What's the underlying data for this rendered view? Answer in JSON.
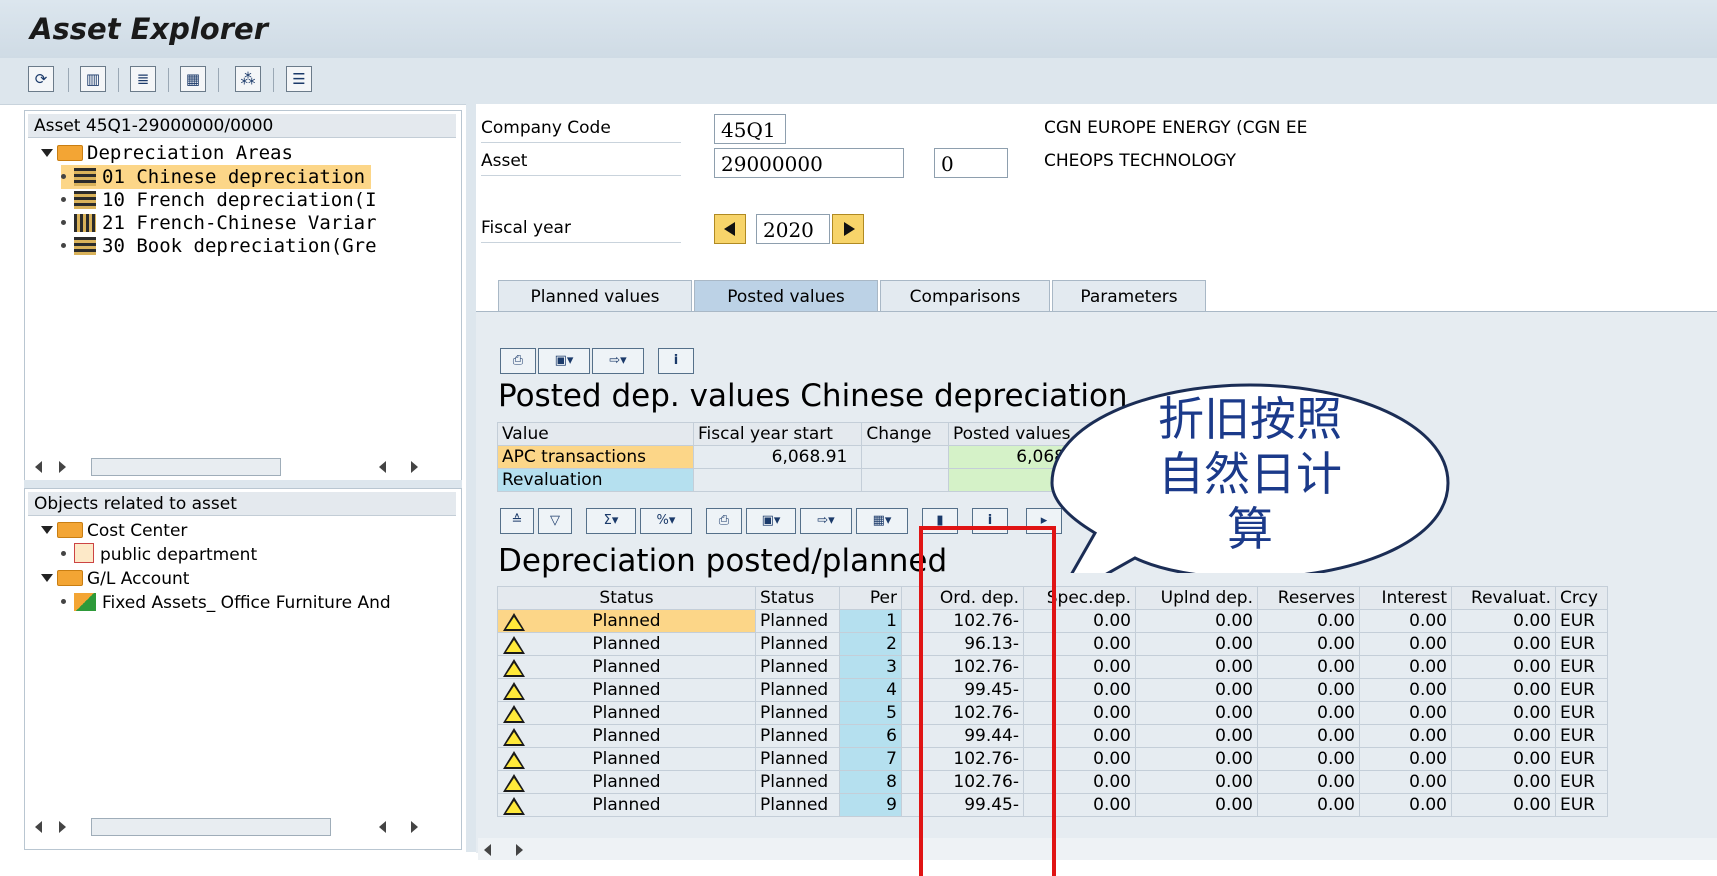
{
  "app": {
    "title": "Asset Explorer"
  },
  "toolbar": {
    "icons": [
      "refresh-icon",
      "save-icon",
      "filter-icon",
      "layout-icon",
      "hierarchy-icon",
      "list-icon"
    ]
  },
  "tree": {
    "header": "Asset 45Q1-29000000/0000",
    "root_label": "Depreciation Areas",
    "items": [
      {
        "label": "01 Chinese depreciation"
      },
      {
        "label": "10 French depreciation(I"
      },
      {
        "label": "21 French-Chinese Variar"
      },
      {
        "label": "30 Book depreciation(Gre"
      }
    ]
  },
  "objects": {
    "header": "Objects related to asset",
    "cost_center": "Cost Center",
    "cost_center_item": "public department",
    "gl_account": "G/L Account",
    "gl_item": "Fixed Assets_ Office Furniture And"
  },
  "header_fields": {
    "company_code_label": "Company Code",
    "company_code_value": "45Q1",
    "company_name": "CGN EUROPE ENERGY (CGN EE",
    "asset_label": "Asset",
    "asset_value": "29000000",
    "asset_sub": "0",
    "asset_name": "CHEOPS TECHNOLOGY",
    "fiscal_year_label": "Fiscal year",
    "fiscal_year_value": "2020"
  },
  "tabs": [
    "Planned values",
    "Posted values",
    "Comparisons",
    "Parameters"
  ],
  "active_tab": "Posted values",
  "posted_section": {
    "title": "Posted dep. values Chinese depreciation",
    "columns": [
      "Value",
      "Fiscal year start",
      "Change",
      "Posted values"
    ],
    "rows": [
      {
        "value": "APC transactions",
        "fy_start": "6,068.91",
        "change": "",
        "posted": "6,068.91"
      },
      {
        "value": "Revaluation",
        "fy_start": "",
        "change": "",
        "posted": ""
      }
    ]
  },
  "depr_section": {
    "title": "Depreciation posted/planned",
    "columns": [
      "Status",
      "Status",
      "Per",
      "Ord. dep.",
      "Spec.dep.",
      "Uplnd dep.",
      "Reserves",
      "Interest",
      "Revaluat.",
      "Crcy"
    ],
    "rows": [
      {
        "status": "Planned",
        "status2": "Planned",
        "per": "1",
        "ord": "102.76-",
        "spec": "0.00",
        "uplnd": "0.00",
        "res": "0.00",
        "int": "0.00",
        "reval": "0.00",
        "crcy": "EUR"
      },
      {
        "status": "Planned",
        "status2": "Planned",
        "per": "2",
        "ord": "96.13-",
        "spec": "0.00",
        "uplnd": "0.00",
        "res": "0.00",
        "int": "0.00",
        "reval": "0.00",
        "crcy": "EUR"
      },
      {
        "status": "Planned",
        "status2": "Planned",
        "per": "3",
        "ord": "102.76-",
        "spec": "0.00",
        "uplnd": "0.00",
        "res": "0.00",
        "int": "0.00",
        "reval": "0.00",
        "crcy": "EUR"
      },
      {
        "status": "Planned",
        "status2": "Planned",
        "per": "4",
        "ord": "99.45-",
        "spec": "0.00",
        "uplnd": "0.00",
        "res": "0.00",
        "int": "0.00",
        "reval": "0.00",
        "crcy": "EUR"
      },
      {
        "status": "Planned",
        "status2": "Planned",
        "per": "5",
        "ord": "102.76-",
        "spec": "0.00",
        "uplnd": "0.00",
        "res": "0.00",
        "int": "0.00",
        "reval": "0.00",
        "crcy": "EUR"
      },
      {
        "status": "Planned",
        "status2": "Planned",
        "per": "6",
        "ord": "99.44-",
        "spec": "0.00",
        "uplnd": "0.00",
        "res": "0.00",
        "int": "0.00",
        "reval": "0.00",
        "crcy": "EUR"
      },
      {
        "status": "Planned",
        "status2": "Planned",
        "per": "7",
        "ord": "102.76-",
        "spec": "0.00",
        "uplnd": "0.00",
        "res": "0.00",
        "int": "0.00",
        "reval": "0.00",
        "crcy": "EUR"
      },
      {
        "status": "Planned",
        "status2": "Planned",
        "per": "8",
        "ord": "102.76-",
        "spec": "0.00",
        "uplnd": "0.00",
        "res": "0.00",
        "int": "0.00",
        "reval": "0.00",
        "crcy": "EUR"
      },
      {
        "status": "Planned",
        "status2": "Planned",
        "per": "9",
        "ord": "99.45-",
        "spec": "0.00",
        "uplnd": "0.00",
        "res": "0.00",
        "int": "0.00",
        "reval": "0.00",
        "crcy": "EUR"
      }
    ]
  },
  "annotation": {
    "callout_lines": [
      "折旧按照",
      "自然日计",
      "算"
    ],
    "highlight_color": "#e01414"
  }
}
